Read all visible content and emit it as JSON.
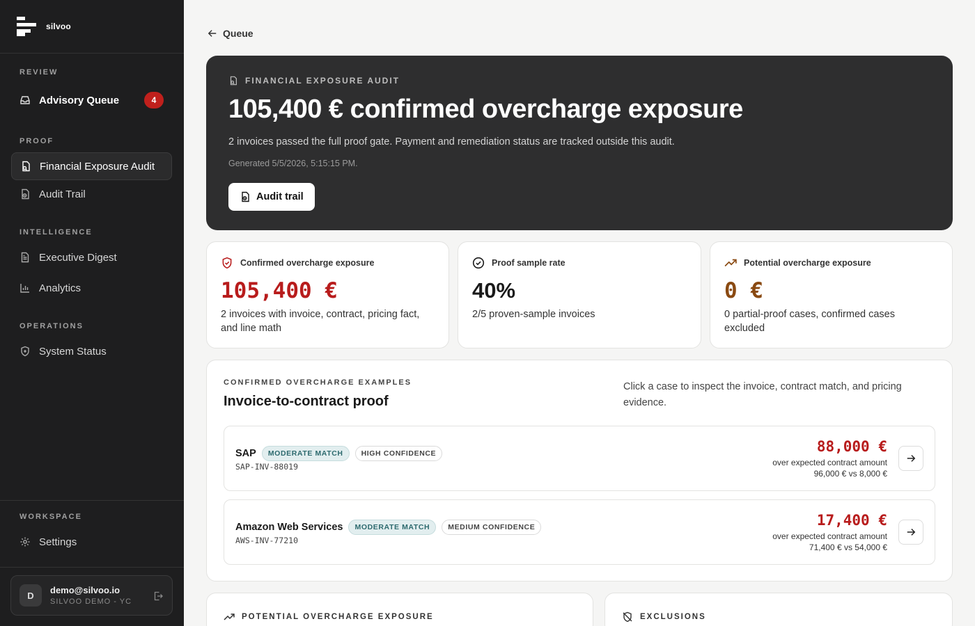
{
  "brand": {
    "name": "silvoo"
  },
  "sidebar": {
    "sections": {
      "review": "REVIEW",
      "proof": "PROOF",
      "intelligence": "INTELLIGENCE",
      "operations": "OPERATIONS",
      "workspace": "WORKSPACE"
    },
    "items": {
      "advisory_queue": {
        "label": "Advisory Queue",
        "badge": "4"
      },
      "financial_exposure_audit": {
        "label": "Financial Exposure Audit"
      },
      "audit_trail": {
        "label": "Audit Trail"
      },
      "executive_digest": {
        "label": "Executive Digest"
      },
      "analytics": {
        "label": "Analytics"
      },
      "system_status": {
        "label": "System Status"
      },
      "settings": {
        "label": "Settings"
      }
    },
    "user": {
      "initial": "D",
      "email": "demo@silvoo.io",
      "org": "SILVOO DEMO - YC"
    }
  },
  "main": {
    "back_label": "Queue",
    "hero": {
      "eyebrow": "FINANCIAL EXPOSURE AUDIT",
      "title": "105,400 € confirmed overcharge exposure",
      "description": "2 invoices passed the full proof gate. Payment and remediation status are tracked outside this audit.",
      "generated": "Generated 5/5/2026, 5:15:15 PM.",
      "button": "Audit trail"
    },
    "kpis": [
      {
        "label": "Confirmed overcharge exposure",
        "value": "105,400 €",
        "sub": "2 invoices with invoice, contract, pricing fact, and line math",
        "color": "#b81c1c"
      },
      {
        "label": "Proof sample rate",
        "value": "40%",
        "sub": "2/5 proven-sample invoices",
        "color": "#1a1a1a"
      },
      {
        "label": "Potential overcharge exposure",
        "value": "0 €",
        "sub": "0 partial-proof cases, confirmed cases excluded",
        "color": "#8a4a12"
      }
    ],
    "examples": {
      "eyebrow": "CONFIRMED OVERCHARGE EXAMPLES",
      "title": "Invoice-to-contract proof",
      "help": "Click a case to inspect the invoice, contract match, and pricing evidence.",
      "cases": [
        {
          "vendor": "SAP",
          "match": "MODERATE MATCH",
          "confidence": "HIGH CONFIDENCE",
          "invoice_id": "SAP-INV-88019",
          "amount": "88,000 €",
          "note": "over expected contract amount",
          "comparison": "96,000 € vs 8,000 €"
        },
        {
          "vendor": "Amazon Web Services",
          "match": "MODERATE MATCH",
          "confidence": "MEDIUM CONFIDENCE",
          "invoice_id": "AWS-INV-77210",
          "amount": "17,400 €",
          "note": "over expected contract amount",
          "comparison": "71,400 € vs 54,000 €"
        }
      ]
    },
    "potential_title": "POTENTIAL OVERCHARGE EXPOSURE",
    "exclusions_title": "EXCLUSIONS"
  }
}
